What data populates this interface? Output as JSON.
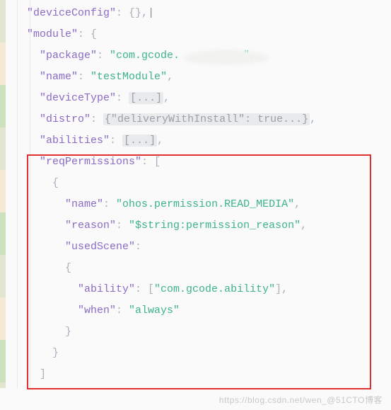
{
  "code": {
    "l1_key": "\"deviceConfig\"",
    "l1_val": ": {}",
    "l1_comma": ",",
    "l2_key": "\"module\"",
    "l2_val": ": {",
    "l3_key": "\"package\"",
    "l3_colon": ": ",
    "l3_val": "\"com.gcode.          \"",
    "l3_comma": ",",
    "l4_key": "\"name\"",
    "l4_colon": ": ",
    "l4_val": "\"testModule\"",
    "l4_comma": ",",
    "l5_key": "\"deviceType\"",
    "l5_colon": ": ",
    "l5_fold": "[...]",
    "l5_comma": ",",
    "l6_key": "\"distro\"",
    "l6_colon": ": ",
    "l6_fold": "{\"deliveryWithInstall\": true...}",
    "l6_comma": ",",
    "l7_key": "\"abilities\"",
    "l7_colon": ": ",
    "l7_fold": "[...]",
    "l7_comma": ",",
    "l8_key": "\"reqPermissions\"",
    "l8_val": ": [",
    "l9_brace": "{",
    "l10_key": "\"name\"",
    "l10_colon": ": ",
    "l10_val": "\"ohos.permission.READ_MEDIA\"",
    "l10_comma": ",",
    "l11_key": "\"reason\"",
    "l11_colon": ": ",
    "l11_val": "\"$string:permission_reason\"",
    "l11_comma": ",",
    "l12_key": "\"usedScene\"",
    "l12_colon": ":",
    "l13_brace": "{",
    "l14_key": "\"ability\"",
    "l14_colon": ": [",
    "l14_val": "\"com.gcode.ability\"",
    "l14_close": "],",
    "l15_key": "\"when\"",
    "l15_colon": ": ",
    "l15_val": "\"always\"",
    "l16_brace": "}",
    "l17_brace": "}",
    "l18_bracket": "]"
  },
  "watermark": "https://blog.csdn.net/wen_@51CTO博客"
}
